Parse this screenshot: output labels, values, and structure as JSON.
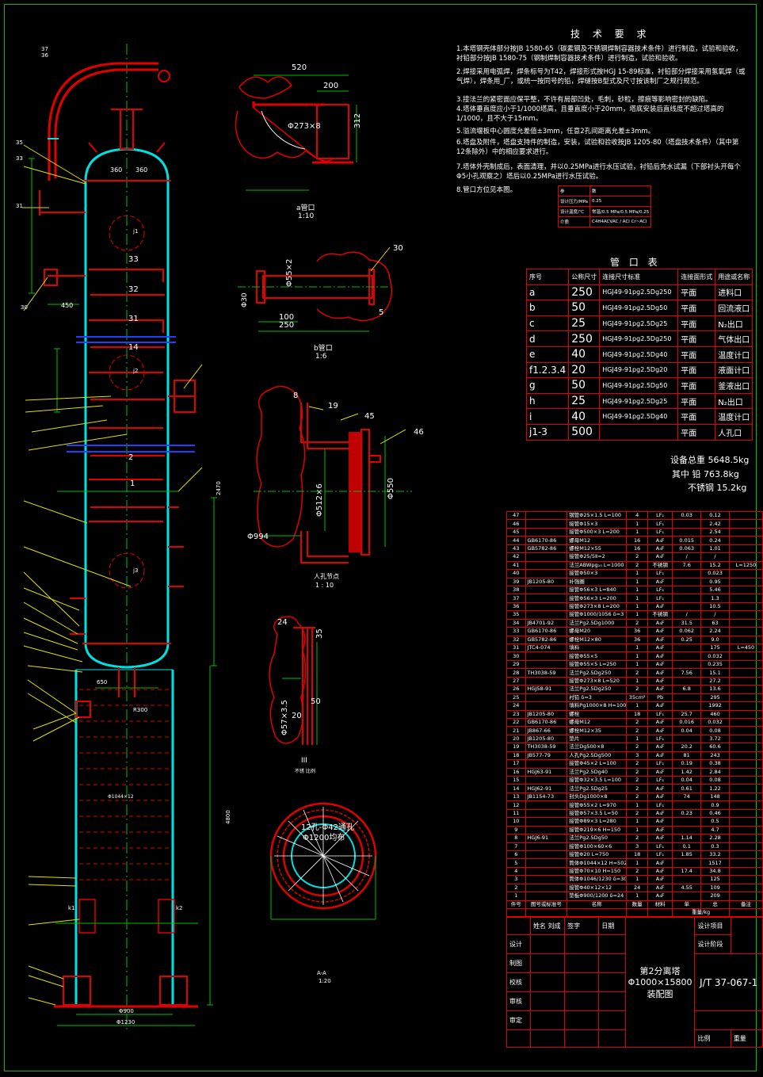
{
  "requirements": {
    "title": "技 术 要 求",
    "items": [
      "1.本塔钢壳体部分按JB 1580-65（碳素钢及不锈钢焊制容器技术条件）进行制造，试验和验收，衬铅部分按JB 1580-75（钢制焊制容器技术条件）进行制造，试验和验收。",
      "2.焊接采用电弧焊，焊条标号为T42，焊接形式按HGJ 15-89标准，衬铅部分焊接采用氢氧焊（或气焊），焊条用_厂，或统一按同号的铅，焊缝按B型式及尺寸按该制厂之规行规范。",
      "3.接法兰的紧密面应保平整，不许有局部凹处，毛刺，砂粒，擦痕等影响密封的缺陷。",
      "4.塔体垂直度应小于1/1000塔高，且垂直度小于20mm，塔底安装后直线度不超过塔高的1/1000，且不大于15mm。",
      "5.溢流堰板中心圆度允差值±3mm，任意2孔间距离允差±3mm。",
      "6.塔盘及附件，塔盘支持件的制造，安装，试验和验收按JB 1205-80（塔盘技术条件）（其中第12条除外）中的相应要求进行。",
      "7.塔体外壳制成后，表面清理，并以0.25MPa进行水压试验，衬铅后充水试漏（下部衬头开每个Φ5小孔观察之）塔后以0.25MPa进行水压试验。",
      "8.管口方位见本图。"
    ]
  },
  "design_table": {
    "header": [
      "参",
      "数"
    ],
    "rows": [
      [
        "设计压力/MPa",
        "0.25"
      ],
      [
        "设计温度/℃",
        "常温/0.5 MPa/0.5 MPa/0.25"
      ],
      [
        "介质",
        "C4H4ACVAC / ACl Cr~ACl"
      ]
    ]
  },
  "nozzle_table": {
    "title": "管 口 表",
    "headers": [
      "序号",
      "公称尺寸",
      "连接尺寸标准",
      "连接面形式",
      "用途或名称"
    ],
    "rows": [
      [
        "a",
        "250",
        "HGJ49-91pg2.5Dg250",
        "平面",
        "进料口"
      ],
      [
        "b",
        "50",
        "HGJ49-91pg2.5Dg50",
        "平面",
        "回流液口"
      ],
      [
        "c",
        "25",
        "HGJ49-91pg2.5Dg25",
        "平面",
        "N₂出口"
      ],
      [
        "d",
        "250",
        "HGJ49-91pg2.5Dg250",
        "平面",
        "气体出口"
      ],
      [
        "e",
        "40",
        "HGJ49-91pg2.5Dg40",
        "平面",
        "温度计口"
      ],
      [
        "f1.2.3.4",
        "20",
        "HGJ49-91pg2.5Dg20",
        "平面",
        "液面计口"
      ],
      [
        "g",
        "50",
        "HGJ49-91pg2.5Dg50",
        "平面",
        "釜液出口"
      ],
      [
        "h",
        "25",
        "HGJ49-91pg2.5Dg25",
        "平面",
        "N₂出口"
      ],
      [
        "i",
        "40",
        "HGJ49-91pg2.5Dg40",
        "平面",
        "温度计口"
      ],
      [
        "j1-3",
        "500",
        "",
        "平面",
        "人孔口"
      ]
    ]
  },
  "weights": {
    "total_label": "设备总重",
    "total": "5648.5kg",
    "lead_label": "其中 铅",
    "lead": "763.8kg",
    "ss_label": "不锈钢",
    "ss": "15.2kg"
  },
  "parts_rows": [
    [
      "47",
      "",
      "钢管Φ25×1.5 L=100",
      "4",
      "LF₁",
      "0.03",
      "0.12",
      ""
    ],
    [
      "46",
      "",
      "接管Φ15×3",
      "1",
      "LF₁",
      "",
      "2.42",
      ""
    ],
    [
      "45",
      "",
      "接管Φ500×3 L=200",
      "1",
      "LF₁",
      "",
      "2.54",
      ""
    ],
    [
      "44",
      "GB6170-86",
      "螺母M12",
      "16",
      "A₃F",
      "0.015",
      "0.24",
      ""
    ],
    [
      "43",
      "GB5782-86",
      "螺栓M12×55",
      "16",
      "A₃F",
      "0.063",
      "1.01",
      ""
    ],
    [
      "42",
      "",
      "接管Φ25/5Ⅱ=2",
      "2",
      "A₃F",
      "/",
      "/",
      ""
    ],
    [
      "41",
      "",
      "法兰ABWpg₁₀ L=1000",
      "2",
      "不锈钢",
      "7.6",
      "15.2",
      "L=1250"
    ],
    [
      "40",
      "",
      "接管Φ50×3",
      "1",
      "LF₁",
      "",
      "0.023",
      ""
    ],
    [
      "39",
      "JB1205-80",
      "补强圈",
      "1",
      "A₃F",
      "",
      "0.95",
      ""
    ],
    [
      "38",
      "",
      "接管Φ56×3 L=840",
      "1",
      "LF₁",
      "",
      "5.46",
      ""
    ],
    [
      "37",
      "",
      "接管Φ56×3 L=200",
      "1",
      "LF₁",
      "",
      "1.3",
      ""
    ],
    [
      "36",
      "",
      "接管Φ273×8 L=200",
      "1",
      "A₃F",
      "",
      "10.5",
      ""
    ],
    [
      "35",
      "",
      "接管Φ1000/1056 δ=3",
      "1",
      "不锈钢",
      "/",
      "/",
      ""
    ],
    [
      "34",
      "JB4701-92",
      "法兰Pg2.5Dg1000",
      "2",
      "A₃F",
      "31.5",
      "63",
      ""
    ],
    [
      "33",
      "GB6170-86",
      "螺母M20",
      "36",
      "A₃F",
      "0.062",
      "2.24",
      ""
    ],
    [
      "32",
      "GB5782-86",
      "螺栓M12×80",
      "36",
      "A₃F",
      "0.25",
      "9.0",
      ""
    ],
    [
      "31",
      "JTC4-074",
      "填料",
      "1",
      "A₃F",
      "",
      "175",
      "L=450"
    ],
    [
      "30",
      "",
      "接管Φ55×5",
      "1",
      "A₃F",
      "",
      "0.032",
      ""
    ],
    [
      "29",
      "",
      "接管Φ55×5 L=250",
      "1",
      "A₃F",
      "",
      "0.235",
      ""
    ],
    [
      "28",
      "TH3038-59",
      "法兰Pg2.5Dg250",
      "2",
      "A₃F",
      "7.56",
      "15.1",
      ""
    ],
    [
      "27",
      "",
      "接管Φ273×8 L=520",
      "1",
      "A₃F",
      "",
      "27.2",
      ""
    ],
    [
      "26",
      "HGJ58-91",
      "法兰Pg2.5Dg250",
      "2",
      "A₃F",
      "6.8",
      "13.6",
      ""
    ],
    [
      "25",
      "",
      "衬铅 δ=3",
      "35cm²",
      "Pb",
      "",
      "295",
      ""
    ],
    [
      "24",
      "",
      "填料Pg1000×8 H=10000",
      "1",
      "A₃F",
      "",
      "1992",
      ""
    ],
    [
      "23",
      "JB1205-80",
      "螺栓",
      "18",
      "LF₁",
      "25.7",
      "460",
      ""
    ],
    [
      "22",
      "GB6170-86",
      "螺母M12",
      "2",
      "A₃F",
      "0.016",
      "0.032",
      ""
    ],
    [
      "21",
      "JB867-66",
      "螺栓M12×35",
      "2",
      "A₃F",
      "0.04",
      "0.08",
      ""
    ],
    [
      "20",
      "JB1205-80",
      "垫片",
      "1",
      "LF₁",
      "",
      "3.72",
      ""
    ],
    [
      "19",
      "TH3038-59",
      "法兰Dg500×8",
      "2",
      "A₃F",
      "20.2",
      "60.6",
      ""
    ],
    [
      "18",
      "JB577-79",
      "人孔Pg2.5Dg500",
      "3",
      "A₃F",
      "81",
      "243",
      ""
    ],
    [
      "17",
      "",
      "接管Φ45×2 L=100",
      "2",
      "LF₁",
      "0.19",
      "0.38",
      ""
    ],
    [
      "16",
      "HGJ63-91",
      "法兰Pg2.5Dg40",
      "2",
      "A₃F",
      "1.42",
      "2.84",
      ""
    ],
    [
      "15",
      "",
      "接管Φ32×3.5 L=100",
      "2",
      "LF₁",
      "0.04",
      "0.08",
      ""
    ],
    [
      "14",
      "HGJ62-91",
      "法兰Pg2.5Dg25",
      "2",
      "A₃F",
      "0.61",
      "1.22",
      ""
    ],
    [
      "13",
      "JB1154-73",
      "封头Dg1000×8",
      "2",
      "A₃F",
      "74",
      "148",
      ""
    ],
    [
      "12",
      "",
      "接管Φ55×2 L=970",
      "1",
      "LF₁",
      "",
      "0.9",
      ""
    ],
    [
      "11",
      "",
      "接管Φ57×3.5 L=50",
      "2",
      "A₃F",
      "0.23",
      "0.46",
      ""
    ],
    [
      "10",
      "",
      "接管Φ89×3 L=280",
      "1",
      "A₃F",
      "",
      "0.5",
      ""
    ],
    [
      "9",
      "",
      "接管Φ219×6 H=150",
      "1",
      "A₃F",
      "",
      "4.7",
      ""
    ],
    [
      "8",
      "HGJ6-91",
      "法兰Pg2.5Dg50",
      "2",
      "A₃F",
      "1.14",
      "2.28",
      ""
    ],
    [
      "7",
      "",
      "接管Φ100×60×6",
      "3",
      "LF₁",
      "0.1",
      "0.3",
      ""
    ],
    [
      "6",
      "",
      "接管Φ20 L=750",
      "18",
      "LF₁",
      "1.85",
      "33.2",
      ""
    ],
    [
      "5",
      "",
      "筒体Φ1044×12 H=5025",
      "1",
      "A₃F",
      "",
      "1517",
      ""
    ],
    [
      "4",
      "",
      "接管Φ70×10 H=150",
      "2",
      "A₃F",
      "17.4",
      "34.8",
      ""
    ],
    [
      "3",
      "",
      "筒体Φ1046/1230 δ=30",
      "1",
      "A₃F",
      "",
      "125",
      ""
    ],
    [
      "2",
      "",
      "接管Φ40×12×12",
      "24",
      "A₃F",
      "4.55",
      "109",
      ""
    ],
    [
      "1",
      "",
      "垫板Φ900/1200 δ=24",
      "1",
      "A₃F",
      "",
      "209",
      ""
    ]
  ],
  "parts_header": [
    "件号",
    "图号或标准号",
    "名称",
    "数量",
    "材料",
    "单",
    "总",
    "备注"
  ],
  "parts_header_sub": "重量/kg",
  "title_block": {
    "r1": [
      "",
      "姓名 刘成",
      "签字",
      "日期"
    ],
    "labels": [
      "设计",
      "制图",
      "校核",
      "审核",
      "审定"
    ],
    "project": "设计项目",
    "stage": "设计阶段",
    "drawing_name": "第2分离塔Φ1000×15800装配图",
    "drawing_no": "J/T 37-067-1",
    "scale": "比例",
    "weight": "重量"
  },
  "labels": {
    "view_a": "a管口",
    "view_a_scale": "1:10",
    "view_b": "b管口",
    "view_b_scale": "1:6",
    "manhole": "人孔节点",
    "manhole_scale": "1 : 10",
    "view_iii": "III",
    "view_iii_note": "不锈 比例",
    "aa": "A-A",
    "aa_scale": "1:20",
    "flange_note": "12孔-Φ42通孔",
    "flange_pcd": "Φ1200均布"
  },
  "dims": {
    "d520": "520",
    "d200": "200",
    "d273": "Φ273×8",
    "d312": "312",
    "d55": "Φ55×2",
    "d30": "30",
    "d30b": "Φ30",
    "d100": "100",
    "d250": "250",
    "d5": "5",
    "d8": "8",
    "d19": "19",
    "d45": "45",
    "d46": "46",
    "d512": "Φ512×6",
    "d550": "Φ550",
    "d994": "Φ994",
    "d24": "24",
    "d35": "35",
    "d57": "Φ57×3.5",
    "d20": "20",
    "d50": "50",
    "d360a": "360",
    "d360b": "360",
    "d450": "450",
    "d650": "650",
    "d2470": "2470",
    "d4800": "4800",
    "d900": "Φ900",
    "d1230": "Φ1230",
    "d1044": "Φ1044×12",
    "dR300": "R300",
    "dk1": "k1",
    "dk2": "k2",
    "dn33": "33",
    "dn32": "32",
    "dn31": "31",
    "dn14": "14",
    "dn2": "2",
    "dn1": "1",
    "dj1": "j1",
    "dj2": "j2",
    "dj3": "j3"
  }
}
